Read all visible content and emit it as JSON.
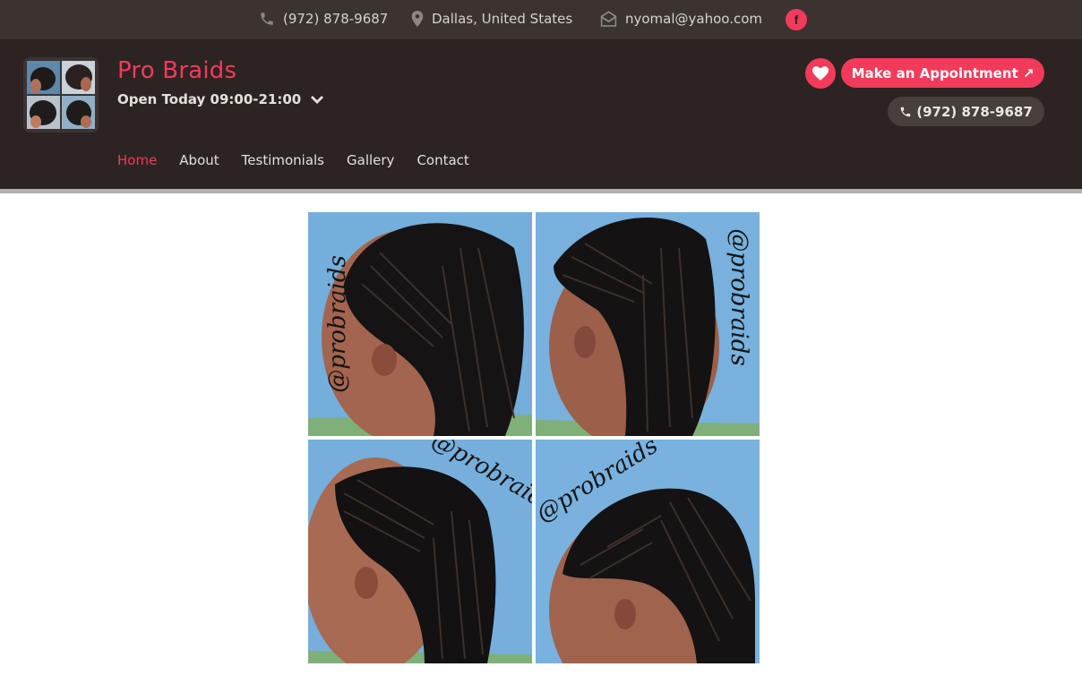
{
  "topbar": {
    "phone": "(972) 878-9687",
    "location": "Dallas, United States",
    "email": "nyomal@yahoo.com",
    "social_icon": "facebook-icon"
  },
  "header": {
    "title": "Pro Braids",
    "hours": "Open Today 09:00-21:00",
    "appointment_label": "Make an Appointment ↗",
    "phone_label": "(972) 878-9687"
  },
  "nav": {
    "items": [
      "Home",
      "About",
      "Testimonials",
      "Gallery",
      "Contact"
    ],
    "active": "Home"
  },
  "gallery": {
    "watermark": "@probraids"
  },
  "colors": {
    "accent": "#f23b5b",
    "topbar_bg": "#3a3330",
    "header_bg": "#2b2422",
    "photo_bg": "#74aedb"
  }
}
